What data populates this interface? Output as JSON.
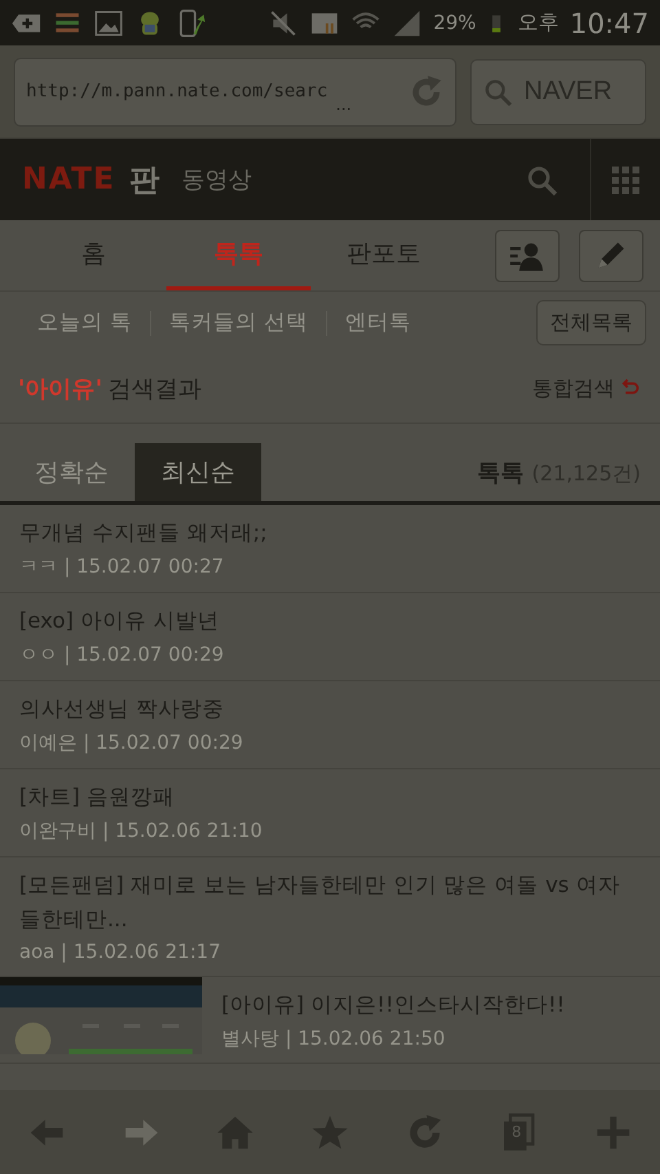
{
  "status_bar": {
    "battery": "29%",
    "ampm": "오후",
    "time": "10:47"
  },
  "browser": {
    "url": "http://m.pann.nate.com/searc",
    "url_more": "...",
    "search": {
      "placeholder": "NAVER"
    }
  },
  "header": {
    "logo": "NATE",
    "logo_sub": "판",
    "section": "동영상"
  },
  "tabs": [
    {
      "label": "홈",
      "selected": false
    },
    {
      "label": "톡톡",
      "selected": true
    },
    {
      "label": "판포토",
      "selected": false
    }
  ],
  "subnav": {
    "items": [
      "오늘의 톡",
      "톡커들의 선택",
      "엔터톡"
    ],
    "all_button": "전체목록"
  },
  "search_result": {
    "query": "'아이유'",
    "label": "검색결과",
    "link": "통합검색"
  },
  "sort_tabs": [
    {
      "label": "정확순",
      "selected": false
    },
    {
      "label": "최신순",
      "selected": true
    }
  ],
  "count": {
    "label": "톡톡",
    "value": "(21,125건)"
  },
  "posts": [
    {
      "kind": "text",
      "title": "무개념 수지팬들 왜저래;;",
      "meta": "ㅋㅋ | 15.02.07 00:27"
    },
    {
      "kind": "text",
      "title": "[exo] 아이유 시발년",
      "meta": "ㅇㅇ | 15.02.07 00:29"
    },
    {
      "kind": "text",
      "title": "의사선생님 짝사랑중",
      "meta": "이예은 | 15.02.07 00:29"
    },
    {
      "kind": "text",
      "title": "[차트] 음원깡패",
      "meta": "이완구비 | 15.02.06 21:10"
    },
    {
      "kind": "text",
      "title": "[모든팬덤] 재미로 보는 남자들한테만 인기 많은 여돌 vs 여자들한테만...",
      "meta": "aoa | 15.02.06 21:17"
    },
    {
      "kind": "thumbnail",
      "title": "[아이유] 이지은!!인스타시작한다!!",
      "meta": "별사탕 | 15.02.06 21:50"
    }
  ],
  "toolbar": [
    {
      "kind": "back",
      "disabled": false
    },
    {
      "kind": "forward",
      "disabled": true
    },
    {
      "kind": "home",
      "disabled": false
    },
    {
      "kind": "star",
      "disabled": false
    },
    {
      "kind": "reload",
      "disabled": false
    },
    {
      "kind": "tabs",
      "disabled": false,
      "count": "8"
    },
    {
      "kind": "add",
      "disabled": false
    }
  ]
}
